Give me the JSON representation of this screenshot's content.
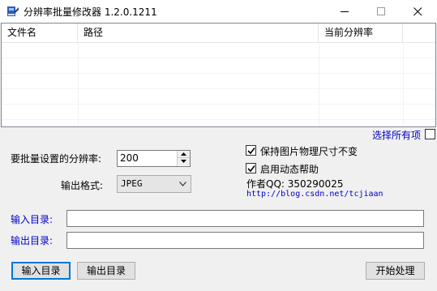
{
  "window": {
    "title": "分辨率批量修改器 1.2.0.1211",
    "icon": "app-icon",
    "controls": [
      "minimize-icon",
      "maximize-icon",
      "close-icon"
    ]
  },
  "file_list": {
    "columns": [
      "文件名",
      "路径",
      "当前分辨率"
    ],
    "rows": []
  },
  "select_all": {
    "label": "选择所有项",
    "checked": false
  },
  "settings": {
    "resolution_label": "要批量设置的分辨率:",
    "resolution_value": "200",
    "format_label": "输出格式:",
    "format_value": "JPEG"
  },
  "options": {
    "keep_physical_size_label": "保持图片物理尺寸不变",
    "keep_physical_size_checked": true,
    "dynamic_help_label": "启用动态帮助",
    "dynamic_help_checked": true,
    "author": "作者QQ: 350290025",
    "url": "http://blog.csdn.net/tcjiaan"
  },
  "directories": {
    "input_label": "输入目录:",
    "input_value": "",
    "output_label": "输出目录:",
    "output_value": ""
  },
  "buttons": {
    "input_dir": "输入目录",
    "output_dir": "输出目录",
    "start": "开始处理"
  },
  "colors": {
    "link_blue": "#0000c8",
    "focus_border": "#0078d7",
    "window_bg": "#f0f0f0"
  }
}
